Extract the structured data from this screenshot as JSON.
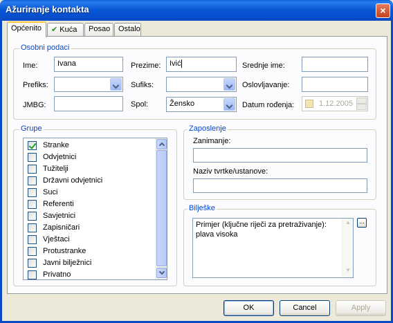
{
  "window": {
    "title": "Ažuriranje kontakta",
    "close_glyph": "×"
  },
  "tabs": [
    {
      "label": "Općenito",
      "active": true
    },
    {
      "label": "Kuća",
      "icon": "checkmark-icon"
    },
    {
      "label": "Posao"
    },
    {
      "label": "Ostalo"
    }
  ],
  "personal": {
    "title": "Osobni podaci",
    "ime_label": "Ime:",
    "ime_value": "Ivana",
    "prezime_label": "Prezime:",
    "prezime_value": "Ivić",
    "srednje_label": "Srednje ime:",
    "srednje_value": "",
    "prefiks_label": "Prefiks:",
    "prefiks_value": "",
    "sufiks_label": "Sufiks:",
    "sufiks_value": "",
    "oslovljavanje_label": "Oslovljavanje:",
    "oslovljavanje_value": "",
    "jmbg_label": "JMBG:",
    "jmbg_value": "",
    "spol_label": "Spol:",
    "spol_value": "Žensko",
    "datum_label": "Datum rođenja:",
    "datum_value": "1.12.2005",
    "datum_checked": false
  },
  "groups": {
    "title": "Grupe",
    "items": [
      {
        "label": "Stranke",
        "checked": true
      },
      {
        "label": "Odvjetnici",
        "checked": false
      },
      {
        "label": "Tužitelji",
        "checked": false
      },
      {
        "label": "Državni odvjetnici",
        "checked": false
      },
      {
        "label": "Suci",
        "checked": false
      },
      {
        "label": "Referenti",
        "checked": false
      },
      {
        "label": "Savjetnici",
        "checked": false
      },
      {
        "label": "Zapisničari",
        "checked": false
      },
      {
        "label": "Vještaci",
        "checked": false
      },
      {
        "label": "Protustranke",
        "checked": false
      },
      {
        "label": "Javni bilježnici",
        "checked": false
      },
      {
        "label": "Privatno",
        "checked": false
      }
    ]
  },
  "employment": {
    "title": "Zaposlenje",
    "zanimanje_label": "Zanimanje:",
    "zanimanje_value": "",
    "tvrtka_label": "Naziv tvrtke/ustanove:",
    "tvrtka_value": ""
  },
  "notes": {
    "title": "Bilješke",
    "text": "Primjer (ključne riječi za pretraživanje): plava visoka",
    "expand_label": "..."
  },
  "buttons": {
    "ok": "OK",
    "cancel": "Cancel",
    "apply": "Apply"
  }
}
